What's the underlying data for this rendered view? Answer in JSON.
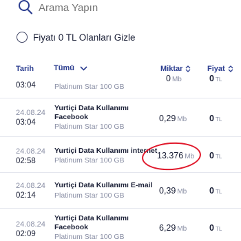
{
  "search": {
    "placeholder": "Arama Yapın"
  },
  "filter": {
    "label": "Fiyatı 0 TL Olanları Gizle"
  },
  "table": {
    "headers": {
      "date": "Tarih",
      "all": "Tümü",
      "amount": "Miktar",
      "price": "Fiyat"
    },
    "rows": [
      {
        "date": "",
        "time": "03:04",
        "title": "",
        "subtitle": "Platinum Star 100 GB",
        "amount": "0",
        "amount_unit": "Mb",
        "price": "0",
        "price_unit": "TL"
      },
      {
        "date": "24.08.24",
        "time": "03:04",
        "title": "Yurtiçi Data Kullanımı Facebook",
        "subtitle": "Platinum Star 100 GB",
        "amount": "0,29",
        "amount_unit": "Mb",
        "price": "0",
        "price_unit": "TL"
      },
      {
        "date": "24.08.24",
        "time": "02:58",
        "title": "Yurtiçi Data Kullanımı internet",
        "subtitle": "Platinum Star 100 GB",
        "amount": "13.376",
        "amount_unit": "Mb",
        "price": "0",
        "price_unit": "TL"
      },
      {
        "date": "24.08.24",
        "time": "02:14",
        "title": "Yurtiçi Data Kullanımı E-mail",
        "subtitle": "Platinum Star 100 GB",
        "amount": "0,39",
        "amount_unit": "Mb",
        "price": "0",
        "price_unit": "TL"
      },
      {
        "date": "24.08.24",
        "time": "02:09",
        "title": "Yurtiçi Data Kullanımı Facebook",
        "subtitle": "Platinum Star 100 GB",
        "amount": "6,29",
        "amount_unit": "Mb",
        "price": "0",
        "price_unit": "TL"
      }
    ]
  },
  "colors": {
    "accent": "#2c3e90",
    "highlight": "#e0182b",
    "muted": "#8a8fa5"
  },
  "icons": {
    "search": "search-icon",
    "sort": "sort-icon",
    "dropdown": "chevron-down-icon"
  }
}
